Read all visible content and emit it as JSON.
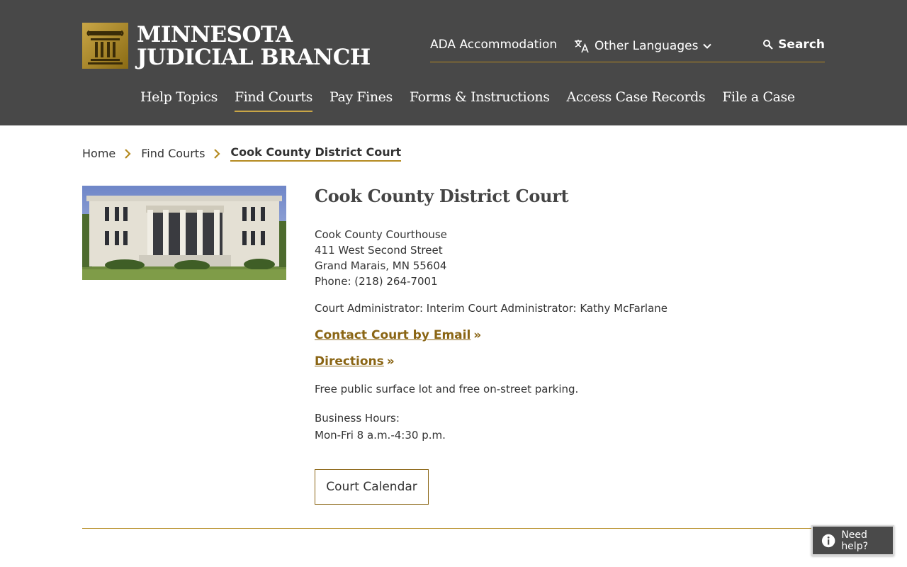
{
  "header": {
    "logo_line1": "MINNESOTA",
    "logo_line2": "JUDICIAL BRANCH",
    "utility": {
      "ada_label": "ADA Accommodation",
      "languages_label": "Other Languages",
      "search_label": "Search"
    },
    "nav": [
      {
        "label": "Help Topics",
        "active": false
      },
      {
        "label": "Find Courts",
        "active": true
      },
      {
        "label": "Pay Fines",
        "active": false
      },
      {
        "label": "Forms & Instructions",
        "active": false
      },
      {
        "label": "Access Case Records",
        "active": false
      },
      {
        "label": "File a Case",
        "active": false
      }
    ]
  },
  "breadcrumb": {
    "items": [
      "Home",
      "Find Courts"
    ],
    "current": "Cook County District Court"
  },
  "court": {
    "title": "Cook County District Court",
    "address_lines": [
      "Cook County Courthouse",
      "411 West Second Street",
      "Grand Marais, MN 55604",
      "Phone: (218) 264-7001"
    ],
    "administrator": "Court Administrator: Interim Court Administrator: Kathy McFarlane",
    "email_link": "Contact Court by Email",
    "directions_link": "Directions",
    "link_suffix": "»",
    "parking": "Free public surface lot and free on-street parking.",
    "hours_label": "Business Hours:",
    "hours_value": "Mon-Fri 8 a.m.-4:30 p.m.",
    "calendar_button": "Court Calendar"
  },
  "help_widget": {
    "label": "Need help?"
  },
  "colors": {
    "header_bg": "#484848",
    "accent_gold": "#b58b21",
    "link_gold": "#8a6514"
  },
  "icons": [
    "courthouse-column-logo-icon",
    "translate-icon",
    "chevron-down-icon",
    "search-icon",
    "chevron-right-icon",
    "info-icon"
  ]
}
